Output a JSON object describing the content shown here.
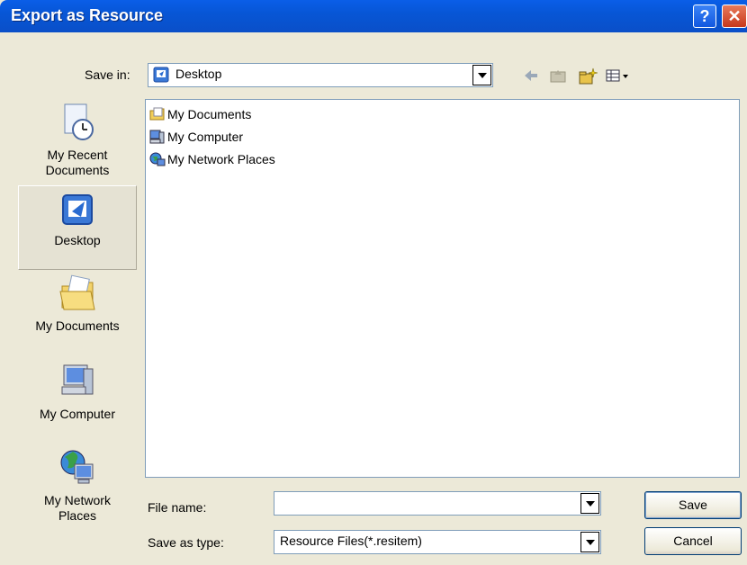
{
  "window": {
    "title": "Export as Resource",
    "help_label": "?",
    "close_label": "✕"
  },
  "save_in": {
    "label": "Save in:",
    "value": "Desktop"
  },
  "places": [
    {
      "label": "My Recent\nDocuments",
      "icon": "recent-documents-icon"
    },
    {
      "label": "Desktop",
      "icon": "desktop-icon",
      "selected": true
    },
    {
      "label": "My Documents",
      "icon": "my-documents-icon"
    },
    {
      "label": "My Computer",
      "icon": "my-computer-icon"
    },
    {
      "label": "My Network\nPlaces",
      "icon": "network-places-icon"
    }
  ],
  "files": [
    {
      "name": "My Documents",
      "icon": "folder-icon"
    },
    {
      "name": "My Computer",
      "icon": "computer-icon"
    },
    {
      "name": "My Network Places",
      "icon": "network-icon"
    }
  ],
  "file_name": {
    "label": "File name:",
    "value": ""
  },
  "save_as_type": {
    "label": "Save as type:",
    "value": "Resource Files(*.resitem)"
  },
  "buttons": {
    "save": "Save",
    "cancel": "Cancel"
  },
  "toolbar": {
    "back": "back-arrow-icon",
    "up": "up-folder-icon",
    "new_folder": "new-folder-icon",
    "views": "views-menu-icon"
  }
}
